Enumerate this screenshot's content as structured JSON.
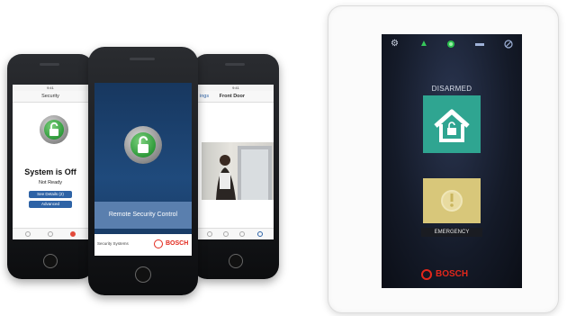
{
  "phone_left": {
    "nav_title": "Security",
    "status_title": "System is Off",
    "status_sub": "Not Ready",
    "btn_details": "See Details (2)",
    "btn_advanced": "Advanced",
    "icons": [
      "tab-home-icon",
      "tab-security-icon",
      "tab-alerts-icon"
    ]
  },
  "phone_center": {
    "banner": "Remote Security Control",
    "footer_left": "Security Systems",
    "brand": "BOSCH",
    "icons": [
      "lock-icon",
      "bosch-logo-icon"
    ]
  },
  "phone_right": {
    "nav_back": "ings",
    "nav_title": "Front Door",
    "icons": [
      "camera-feed-image",
      "tab-icons"
    ]
  },
  "panel": {
    "status": "DISARMED",
    "emergency": "EMERGENCY",
    "brand": "BOSCH",
    "icons": [
      "settings-icon",
      "warning-triangle-icon",
      "status-green-icon",
      "plug-icon",
      "no-service-icon",
      "house-unlock-icon",
      "emergency-icon"
    ],
    "colors": {
      "tile_green": "#2fa591",
      "tile_yellow": "#d8c77a",
      "brand_red": "#e2271b"
    }
  }
}
